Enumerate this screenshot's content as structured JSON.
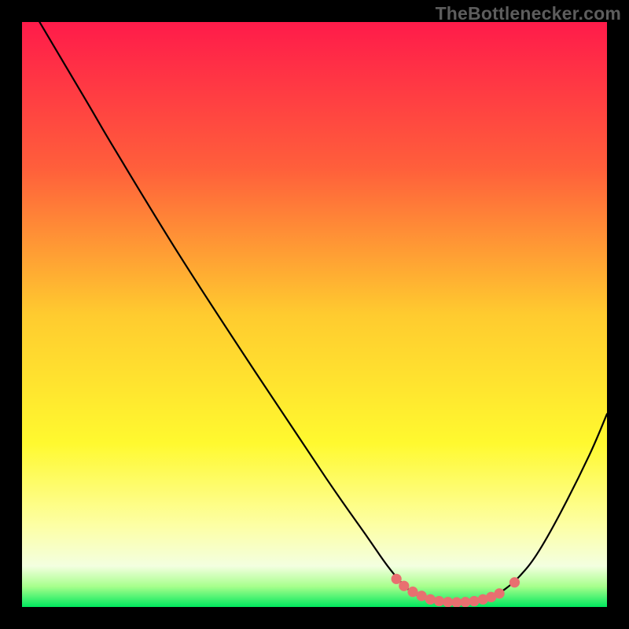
{
  "watermark": "TheBottlenecker.com",
  "chart_data": {
    "type": "line",
    "title": "",
    "xlabel": "",
    "ylabel": "",
    "xlim": [
      0,
      100
    ],
    "ylim": [
      0,
      100
    ],
    "gradient_stops": [
      {
        "offset": 0.0,
        "color": "#ff1b4a"
      },
      {
        "offset": 0.25,
        "color": "#ff5f3b"
      },
      {
        "offset": 0.5,
        "color": "#ffcb2f"
      },
      {
        "offset": 0.72,
        "color": "#fff92f"
      },
      {
        "offset": 0.86,
        "color": "#fdffa4"
      },
      {
        "offset": 0.93,
        "color": "#f3ffe0"
      },
      {
        "offset": 0.965,
        "color": "#a7ff8c"
      },
      {
        "offset": 1.0,
        "color": "#00e85e"
      }
    ],
    "series": [
      {
        "name": "curve",
        "color": "#000000",
        "points": [
          {
            "x": 3.0,
            "y": 100.0
          },
          {
            "x": 11.0,
            "y": 86.5
          },
          {
            "x": 16.0,
            "y": 78.0
          },
          {
            "x": 27.0,
            "y": 60.0
          },
          {
            "x": 40.0,
            "y": 40.0
          },
          {
            "x": 52.0,
            "y": 22.0
          },
          {
            "x": 59.0,
            "y": 12.0
          },
          {
            "x": 62.5,
            "y": 7.0
          },
          {
            "x": 65.5,
            "y": 3.5
          },
          {
            "x": 68.0,
            "y": 1.8
          },
          {
            "x": 71.0,
            "y": 0.9
          },
          {
            "x": 74.0,
            "y": 0.7
          },
          {
            "x": 77.0,
            "y": 0.9
          },
          {
            "x": 80.0,
            "y": 1.6
          },
          {
            "x": 82.5,
            "y": 3.0
          },
          {
            "x": 85.0,
            "y": 5.2
          },
          {
            "x": 88.0,
            "y": 9.0
          },
          {
            "x": 92.0,
            "y": 16.0
          },
          {
            "x": 97.0,
            "y": 26.0
          },
          {
            "x": 100.0,
            "y": 33.0
          }
        ]
      }
    ],
    "markers": [
      {
        "x": 64.0,
        "y": 4.8,
        "r": 3
      },
      {
        "x": 65.3,
        "y": 3.6,
        "r": 3
      },
      {
        "x": 66.8,
        "y": 2.6,
        "r": 3
      },
      {
        "x": 68.3,
        "y": 1.9,
        "r": 3
      },
      {
        "x": 69.8,
        "y": 1.3,
        "r": 3
      },
      {
        "x": 71.3,
        "y": 1.0,
        "r": 3
      },
      {
        "x": 72.8,
        "y": 0.85,
        "r": 3
      },
      {
        "x": 74.3,
        "y": 0.8,
        "r": 3
      },
      {
        "x": 75.8,
        "y": 0.85,
        "r": 3
      },
      {
        "x": 77.3,
        "y": 1.0,
        "r": 3
      },
      {
        "x": 78.8,
        "y": 1.3,
        "r": 3
      },
      {
        "x": 80.2,
        "y": 1.7,
        "r": 3
      },
      {
        "x": 81.6,
        "y": 2.3,
        "r": 3
      },
      {
        "x": 84.2,
        "y": 4.2,
        "r": 3
      }
    ],
    "marker_color": "#e87070"
  }
}
